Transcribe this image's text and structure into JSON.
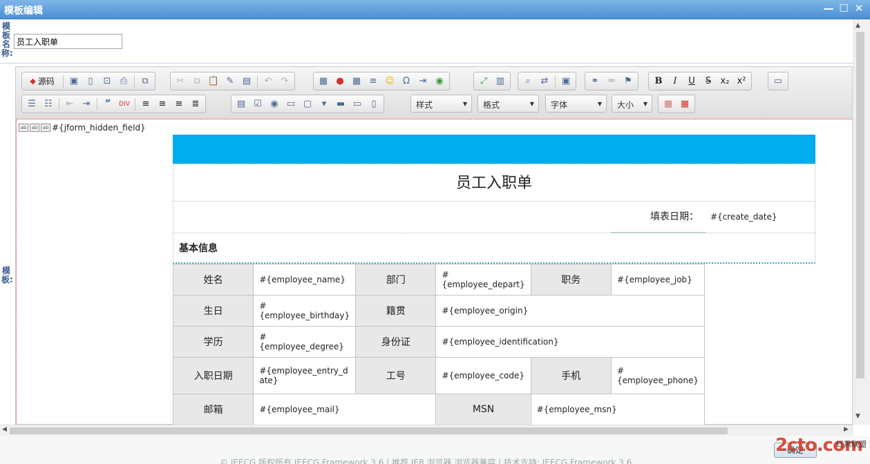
{
  "window": {
    "title": "模板编辑",
    "minimize": "—",
    "maximize": "☐",
    "close": "✕"
  },
  "labels": {
    "template_name": "模\n板\n名\n称:",
    "template": "模\n板:"
  },
  "template_name_value": "员工入职单",
  "toolbar": {
    "source_label": "源码",
    "combos": {
      "style": "样式",
      "format": "格式",
      "font": "字体",
      "size": "大小"
    }
  },
  "hidden_field": "#{jform_hidden_field}",
  "form": {
    "title": "员工入职单",
    "date_label": "填表日期：",
    "date_value": "#{create_date}",
    "section": "基本信息",
    "rows": {
      "r1": {
        "l1": "姓名",
        "v1": "#{employee_name}",
        "l2": "部门",
        "v2": "#{employee_depart}",
        "l3": "职务",
        "v3": "#{employee_job}"
      },
      "r2": {
        "l1": "生日",
        "v1": "#{employee_birthday}",
        "l2": "籍贯",
        "v2": "#{employee_origin}"
      },
      "r3": {
        "l1": "学历",
        "v1": "#{employee_degree}",
        "l2": "身份证",
        "v2": "#{employee_identification}"
      },
      "r4": {
        "l1": "入职日期",
        "v1": "#{employee_entry_date}",
        "l2": "工号",
        "v2": "#{employee_code}",
        "l3": "手机",
        "v3": "#{employee_phone}"
      },
      "r5": {
        "l1": "邮箱",
        "v1": "#{employee_mail}",
        "l2": "MSN",
        "v2": "#{employee_msn}"
      }
    }
  },
  "footer": {
    "ok": "确定",
    "copyright": "© JEECG 版权所有  JEECG Framework 3.6 | 推荐 IE8 浏览器  浏览器兼容 | 技术支持: JEECG Framework 3.6",
    "watermark": "2cto.com",
    "watermark_sub": "红黑联盟"
  },
  "colors": {
    "banner": "#00adef",
    "title_bar": "#4b8fd4"
  }
}
